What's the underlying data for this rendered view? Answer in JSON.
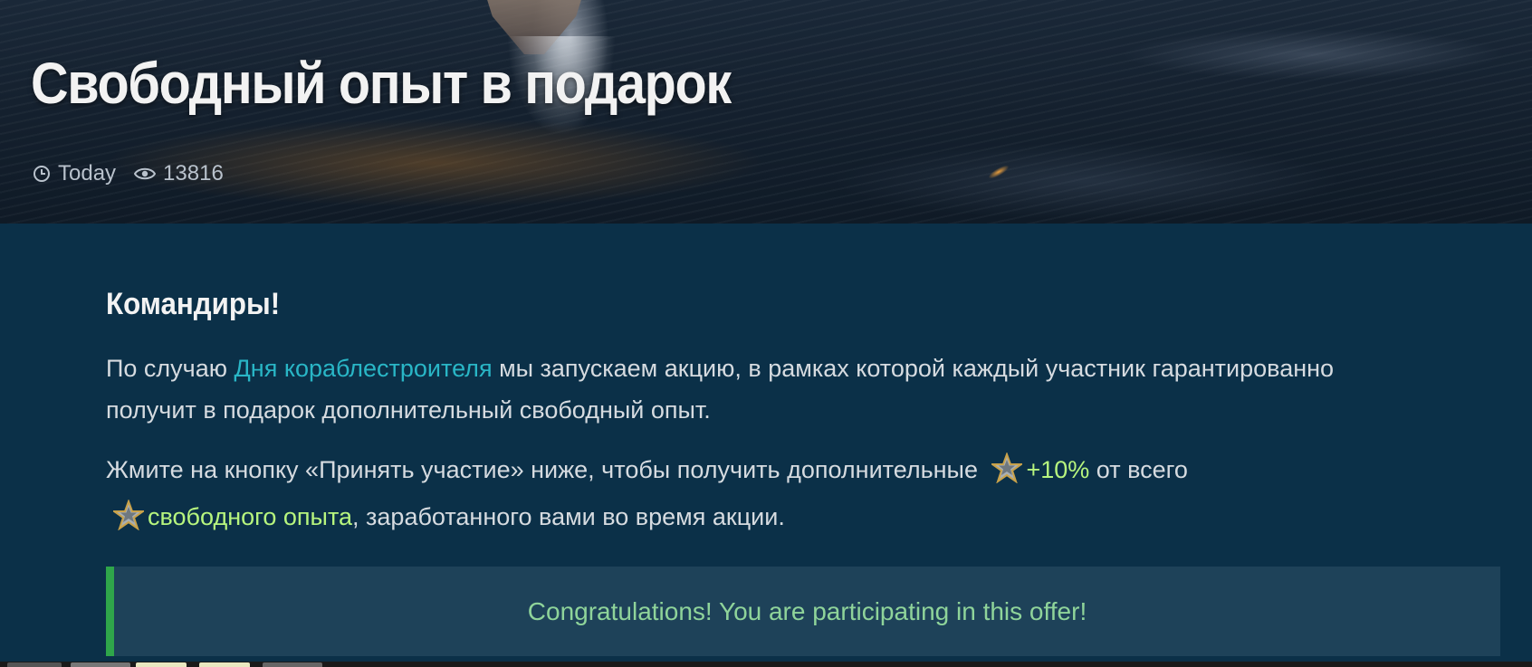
{
  "hero": {
    "title": "Свободный опыт в подарок",
    "date": "Today",
    "views": "13816"
  },
  "article": {
    "heading": "Командиры!",
    "p1": {
      "before": "По случаю ",
      "link": "Дня кораблестроителя",
      "after": " мы запускаем акцию, в рамках которой каждый участник гарантированно получит в подарок дополнительный свободный опыт."
    },
    "p2": {
      "before": "Жмите на кнопку «Принять участие» ниже, чтобы получить дополнительные ",
      "bonus": "+10%",
      "middle": " от всего ",
      "highlight": "свободного опыта",
      "after": ", заработанного вами во время акции."
    },
    "notice": "Congratulations! You are participating in this offer!"
  },
  "icons": {
    "clock": "clock-icon",
    "eye": "eye-icon",
    "star": "free-xp-star-icon"
  },
  "colors": {
    "link": "#29b6c6",
    "highlight": "#b7f57e",
    "notice_text": "#8fd49a",
    "notice_border": "#2fa54a",
    "background": "#0b3048"
  }
}
